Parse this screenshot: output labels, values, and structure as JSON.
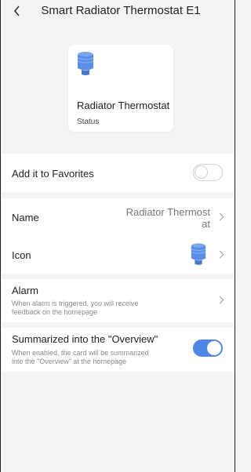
{
  "header": {
    "title": "Smart Radiator Thermostat E1",
    "back_icon": "chevron-left-icon"
  },
  "card": {
    "name": "Radiator Thermostat",
    "status": "Status",
    "icon": "radiator-thermostat-icon",
    "icon_color": "#5b8ee6"
  },
  "favorites": {
    "label": "Add it to Favorites",
    "enabled": false
  },
  "name_row": {
    "label": "Name",
    "value_line1": "Radiator Thermost",
    "value_line2": "at"
  },
  "icon_row": {
    "label": "Icon",
    "icon": "radiator-thermostat-icon"
  },
  "alarm": {
    "label": "Alarm",
    "description_line1": "When alarm is triggered, you will receive",
    "description_line2": "feedback on the homepage"
  },
  "overview": {
    "label": "Summarized into the \"Overview\"",
    "description_line1": "When enabled, the card will be summarized",
    "description_line2": "into the \"Overview\" at the homepage",
    "enabled": true
  },
  "colors": {
    "accent": "#4f86e4",
    "background": "#f4f4f4"
  }
}
